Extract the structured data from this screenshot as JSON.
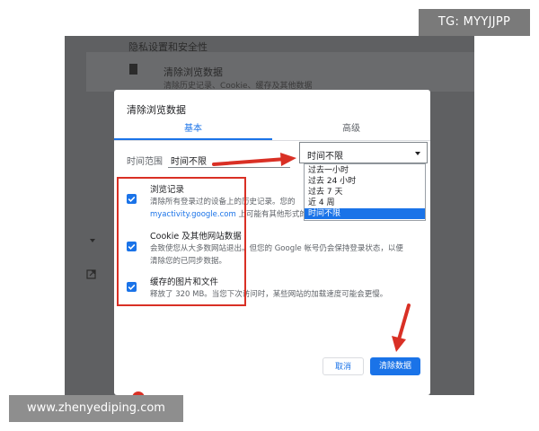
{
  "watermark": {
    "top": "TG: MYYJJPP",
    "bottom": "www.zhenyediping.com"
  },
  "background": {
    "section_title": "隐私设置和安全性",
    "card_title": "清除浏览数据",
    "card_sub": "清除历史记录、Cookie、缓存及其他数据"
  },
  "dialog": {
    "title": "清除浏览数据",
    "tabs": [
      {
        "label": "基本"
      },
      {
        "label": "高级"
      }
    ],
    "time_range_label": "时间范围",
    "time_range_value": "时间不限",
    "items": [
      {
        "title": "浏览记录",
        "desc1": "清除所有登录过的设备上的历史记录。您的",
        "desc2_link": "myactivity.google.com",
        "desc2": " 上可能有其他形式的"
      },
      {
        "title": "Cookie 及其他网站数据",
        "desc1": "会致使您从大多数网站退出。但您的 Google 帐号仍会保持登录状态，以便",
        "desc2": "清除您的已同步数据。"
      },
      {
        "title": "缓存的图片和文件",
        "desc1": "释放了 320 MB。当您下次访问时，某些网站的加载速度可能会更慢。"
      }
    ],
    "cancel_label": "取消",
    "clear_label": "清除数据"
  },
  "dropdown": {
    "value": "时间不限",
    "options": [
      "过去一小时",
      "过去 24 小时",
      "过去 7 天",
      "近 4 周",
      "时间不限"
    ],
    "selected_index": 4
  },
  "colors": {
    "accent": "#1a73e8",
    "highlight": "#d93025"
  }
}
